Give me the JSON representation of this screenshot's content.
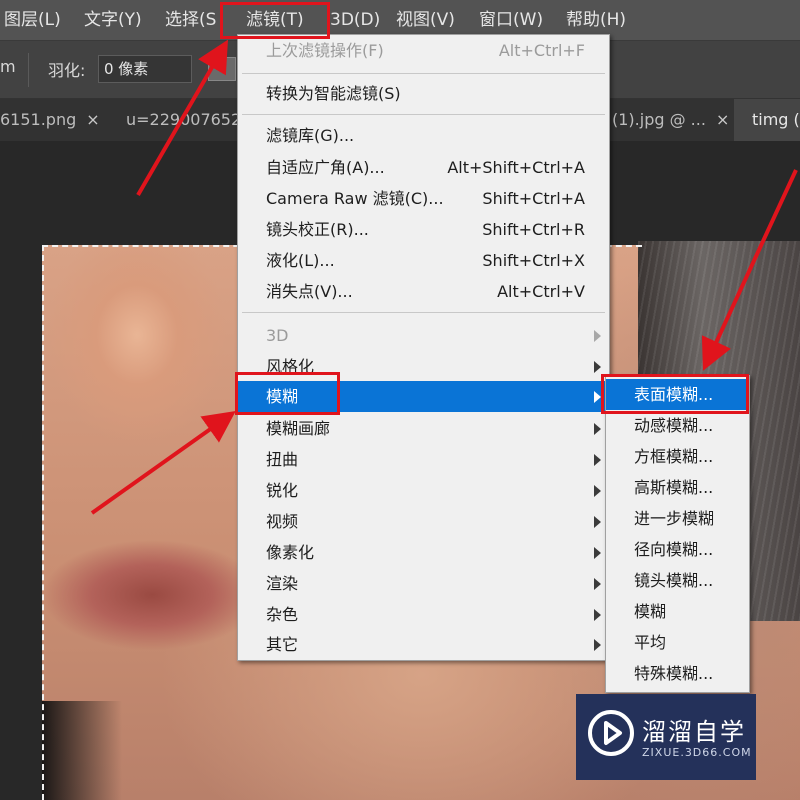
{
  "menubar": {
    "items": [
      "图层(L)",
      "文字(Y)",
      "选择(S",
      "滤镜(T)",
      "3D(D)",
      "视图(V)",
      "窗口(W)",
      "帮助(H)"
    ]
  },
  "options": {
    "left_glyph": "m",
    "feather_label": "羽化:",
    "feather_value": "0 像素"
  },
  "tabs": [
    {
      "label": "6151.png",
      "close": "×"
    },
    {
      "label": "u=229007652",
      "close": ""
    },
    {
      "label": "(1).jpg @ ...",
      "close": "×"
    },
    {
      "label": "timg (",
      "close": ""
    }
  ],
  "filter_menu": {
    "items": [
      {
        "label": "上次滤镜操作(F)",
        "shortcut": "Alt+Ctrl+F",
        "disabled": true
      },
      {
        "label": "转换为智能滤镜(S)",
        "shortcut": ""
      },
      {
        "label": "滤镜库(G)...",
        "shortcut": ""
      },
      {
        "label": "自适应广角(A)...",
        "shortcut": "Alt+Shift+Ctrl+A"
      },
      {
        "label": "Camera Raw 滤镜(C)...",
        "shortcut": "Shift+Ctrl+A"
      },
      {
        "label": "镜头校正(R)...",
        "shortcut": "Shift+Ctrl+R"
      },
      {
        "label": "液化(L)...",
        "shortcut": "Shift+Ctrl+X"
      },
      {
        "label": "消失点(V)...",
        "shortcut": "Alt+Ctrl+V"
      },
      {
        "label": "3D",
        "submenu": true,
        "disabled": true
      },
      {
        "label": "风格化",
        "submenu": true
      },
      {
        "label": "模糊",
        "submenu": true,
        "highlighted": true
      },
      {
        "label": "模糊画廊",
        "submenu": true
      },
      {
        "label": "扭曲",
        "submenu": true
      },
      {
        "label": "锐化",
        "submenu": true
      },
      {
        "label": "视频",
        "submenu": true
      },
      {
        "label": "像素化",
        "submenu": true
      },
      {
        "label": "渲染",
        "submenu": true
      },
      {
        "label": "杂色",
        "submenu": true
      },
      {
        "label": "其它",
        "submenu": true
      }
    ]
  },
  "blur_submenu": {
    "items": [
      {
        "label": "表面模糊...",
        "highlighted": true
      },
      {
        "label": "动感模糊..."
      },
      {
        "label": "方框模糊..."
      },
      {
        "label": "高斯模糊..."
      },
      {
        "label": "进一步模糊"
      },
      {
        "label": "径向模糊..."
      },
      {
        "label": "镜头模糊..."
      },
      {
        "label": "模糊"
      },
      {
        "label": "平均"
      },
      {
        "label": "特殊模糊..."
      }
    ]
  },
  "watermark": {
    "name": "溜溜自学",
    "url": "ZIXUE.3D66.COM"
  },
  "colors": {
    "highlight": "#0a74d6",
    "annotation_red": "#e0141c",
    "watermark_bg": "#24315a"
  }
}
